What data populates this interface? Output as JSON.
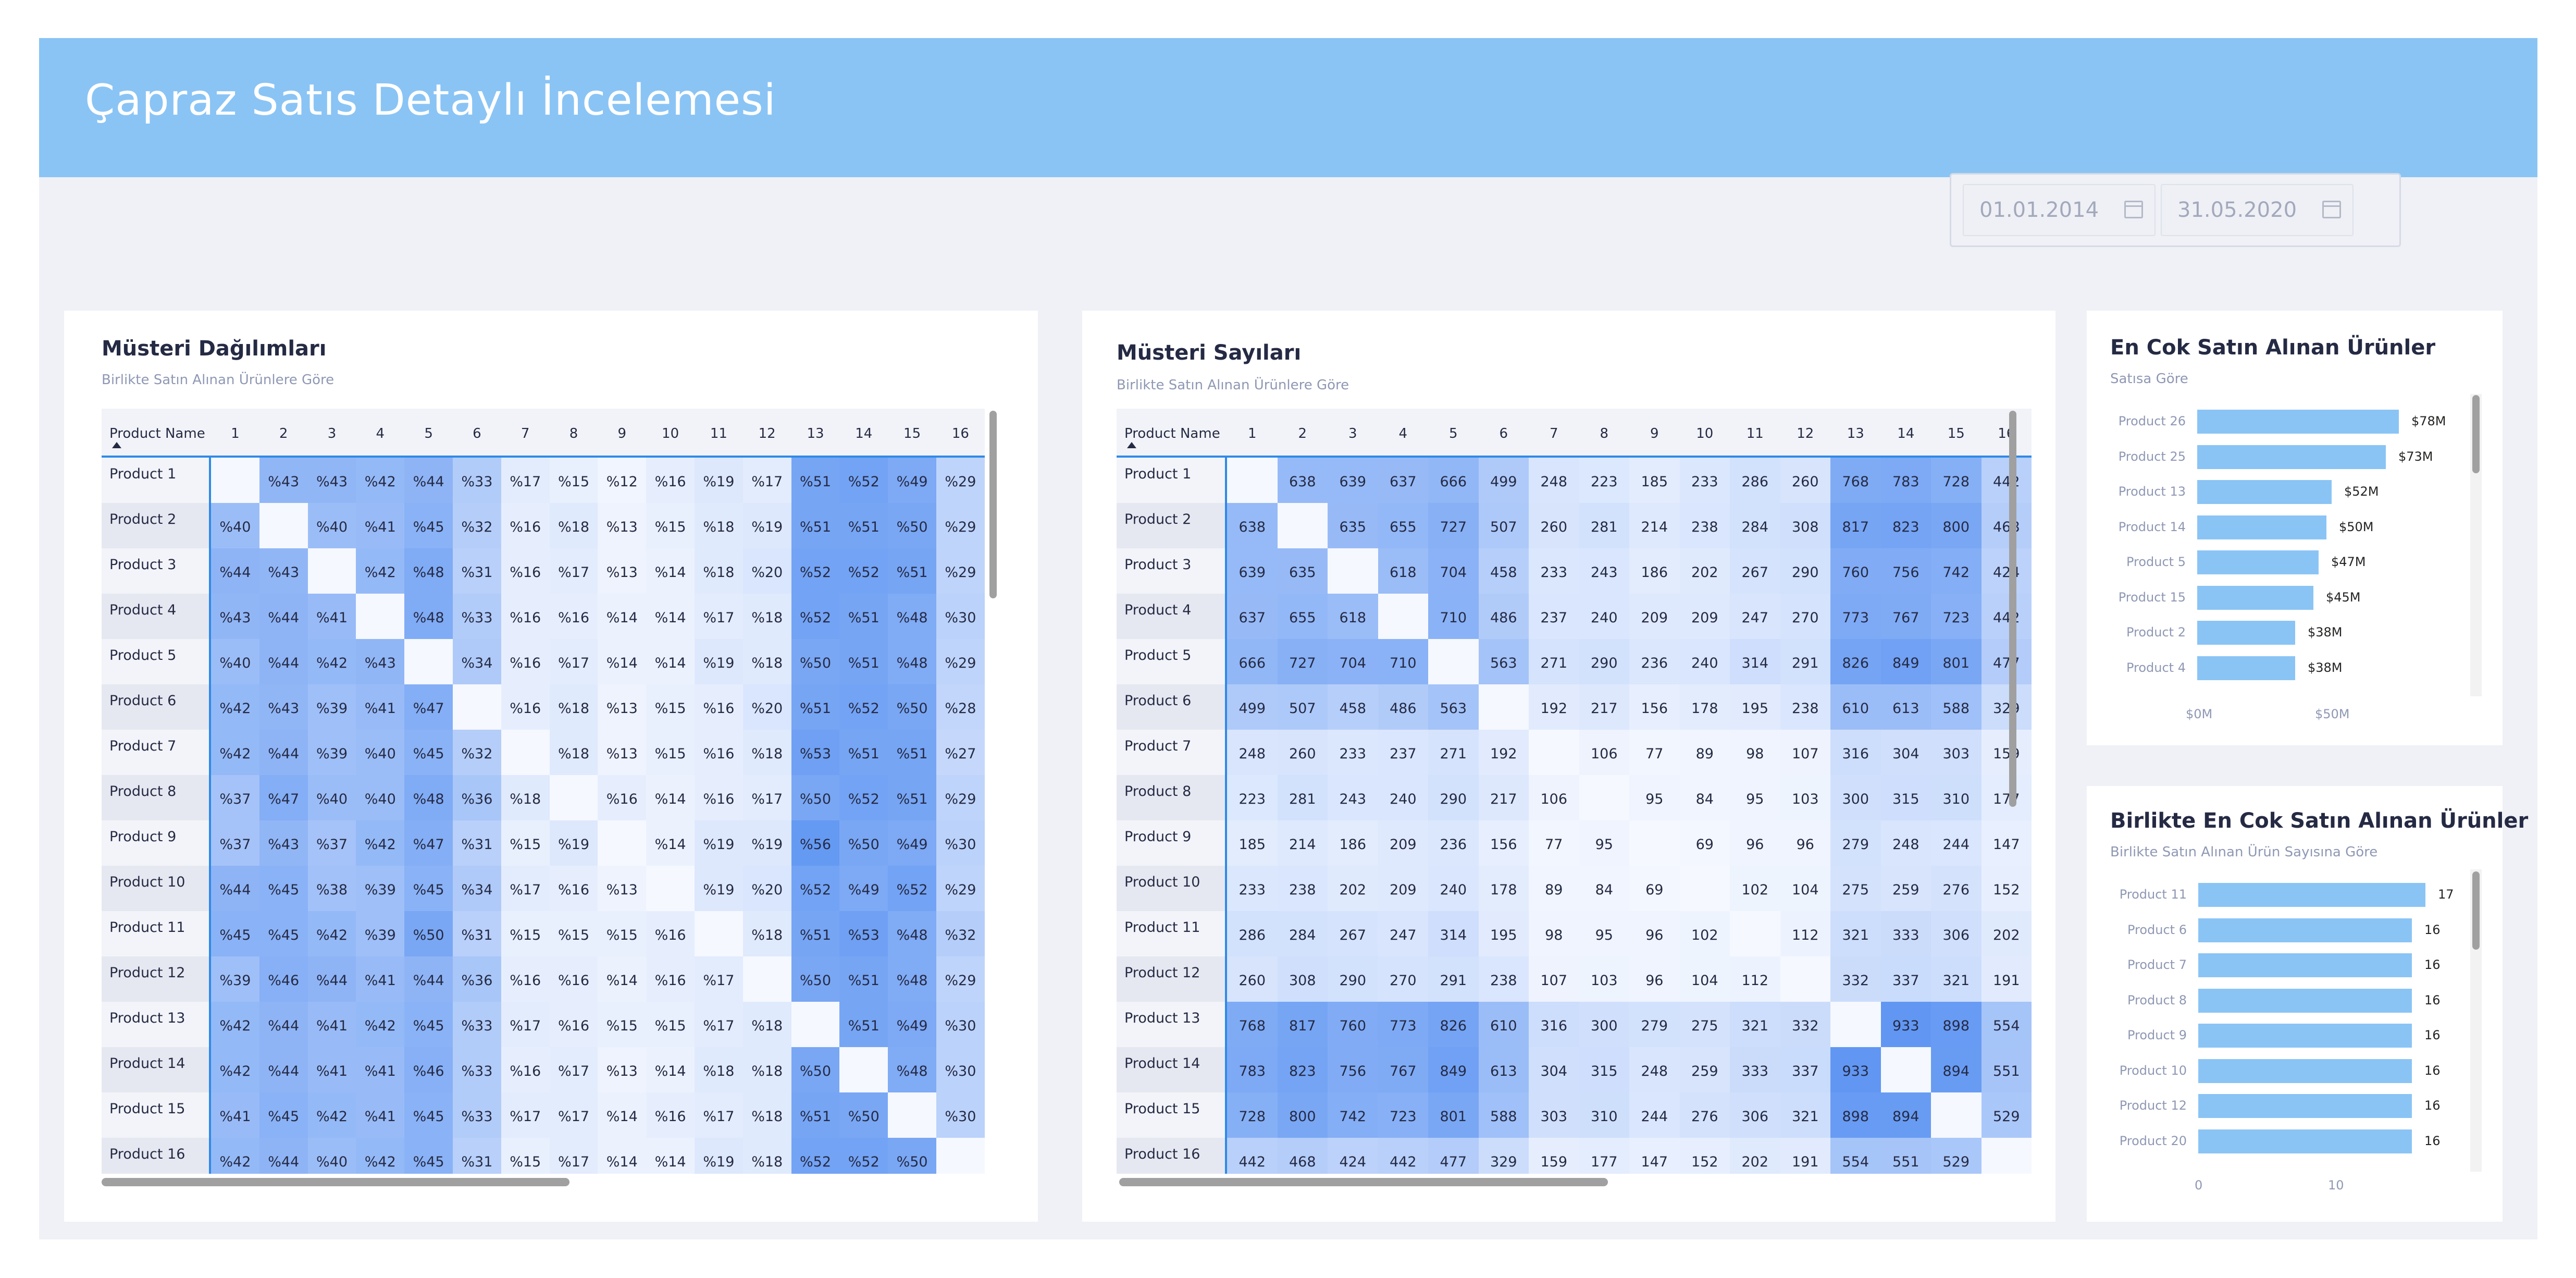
{
  "header": {
    "title": "Çapraz Satıs Detaylı İncelemesi"
  },
  "date_range": {
    "start": "01.01.2014",
    "end": "31.05.2020"
  },
  "colors": {
    "banner": "#8ac4f5",
    "background": "#eff1f6",
    "bar": "#8ac4f5",
    "heat_max": "#5e95f2",
    "accent_line": "#2f8ae8"
  },
  "panel1": {
    "title": "Müsteri Dağılımları",
    "subtitle": "Birlikte Satın Alınan Ürünlere Göre",
    "corner_label": "Product Name",
    "columns": [
      "1",
      "2",
      "3",
      "4",
      "5",
      "6",
      "7",
      "8",
      "9",
      "10",
      "11",
      "12",
      "13",
      "14",
      "15",
      "16"
    ],
    "rows": [
      {
        "label": "Product 1",
        "cells": [
          "",
          "%43",
          "%43",
          "%42",
          "%44",
          "%33",
          "%17",
          "%15",
          "%12",
          "%16",
          "%19",
          "%17",
          "%51",
          "%52",
          "%49",
          "%29"
        ]
      },
      {
        "label": "Product 2",
        "cells": [
          "%40",
          "",
          "%40",
          "%41",
          "%45",
          "%32",
          "%16",
          "%18",
          "%13",
          "%15",
          "%18",
          "%19",
          "%51",
          "%51",
          "%50",
          "%29"
        ]
      },
      {
        "label": "Product 3",
        "cells": [
          "%44",
          "%43",
          "",
          "%42",
          "%48",
          "%31",
          "%16",
          "%17",
          "%13",
          "%14",
          "%18",
          "%20",
          "%52",
          "%52",
          "%51",
          "%29"
        ]
      },
      {
        "label": "Product 4",
        "cells": [
          "%43",
          "%44",
          "%41",
          "",
          "%48",
          "%33",
          "%16",
          "%16",
          "%14",
          "%14",
          "%17",
          "%18",
          "%52",
          "%51",
          "%48",
          "%30"
        ]
      },
      {
        "label": "Product 5",
        "cells": [
          "%40",
          "%44",
          "%42",
          "%43",
          "",
          "%34",
          "%16",
          "%17",
          "%14",
          "%14",
          "%19",
          "%18",
          "%50",
          "%51",
          "%48",
          "%29"
        ]
      },
      {
        "label": "Product 6",
        "cells": [
          "%42",
          "%43",
          "%39",
          "%41",
          "%47",
          "",
          "%16",
          "%18",
          "%13",
          "%15",
          "%16",
          "%20",
          "%51",
          "%52",
          "%50",
          "%28"
        ]
      },
      {
        "label": "Product 7",
        "cells": [
          "%42",
          "%44",
          "%39",
          "%40",
          "%45",
          "%32",
          "",
          "%18",
          "%13",
          "%15",
          "%16",
          "%18",
          "%53",
          "%51",
          "%51",
          "%27"
        ]
      },
      {
        "label": "Product 8",
        "cells": [
          "%37",
          "%47",
          "%40",
          "%40",
          "%48",
          "%36",
          "%18",
          "",
          "%16",
          "%14",
          "%16",
          "%17",
          "%50",
          "%52",
          "%51",
          "%29"
        ]
      },
      {
        "label": "Product 9",
        "cells": [
          "%37",
          "%43",
          "%37",
          "%42",
          "%47",
          "%31",
          "%15",
          "%19",
          "",
          "%14",
          "%19",
          "%19",
          "%56",
          "%50",
          "%49",
          "%30"
        ]
      },
      {
        "label": "Product 10",
        "cells": [
          "%44",
          "%45",
          "%38",
          "%39",
          "%45",
          "%34",
          "%17",
          "%16",
          "%13",
          "",
          "%19",
          "%20",
          "%52",
          "%49",
          "%52",
          "%29"
        ]
      },
      {
        "label": "Product 11",
        "cells": [
          "%45",
          "%45",
          "%42",
          "%39",
          "%50",
          "%31",
          "%15",
          "%15",
          "%15",
          "%16",
          "",
          "%18",
          "%51",
          "%53",
          "%48",
          "%32"
        ]
      },
      {
        "label": "Product 12",
        "cells": [
          "%39",
          "%46",
          "%44",
          "%41",
          "%44",
          "%36",
          "%16",
          "%16",
          "%14",
          "%16",
          "%17",
          "",
          "%50",
          "%51",
          "%48",
          "%29"
        ]
      },
      {
        "label": "Product 13",
        "cells": [
          "%42",
          "%44",
          "%41",
          "%42",
          "%45",
          "%33",
          "%17",
          "%16",
          "%15",
          "%15",
          "%17",
          "%18",
          "",
          "%51",
          "%49",
          "%30"
        ]
      },
      {
        "label": "Product 14",
        "cells": [
          "%42",
          "%44",
          "%41",
          "%41",
          "%46",
          "%33",
          "%16",
          "%17",
          "%13",
          "%14",
          "%18",
          "%18",
          "%50",
          "",
          "%48",
          "%30"
        ]
      },
      {
        "label": "Product 15",
        "cells": [
          "%41",
          "%45",
          "%42",
          "%41",
          "%45",
          "%33",
          "%17",
          "%17",
          "%14",
          "%16",
          "%17",
          "%18",
          "%51",
          "%50",
          "",
          "%30"
        ]
      },
      {
        "label": "Product 16",
        "cells": [
          "%42",
          "%44",
          "%40",
          "%42",
          "%45",
          "%31",
          "%15",
          "%17",
          "%14",
          "%14",
          "%19",
          "%18",
          "%52",
          "%52",
          "%50",
          ""
        ]
      }
    ]
  },
  "panel2": {
    "title": "Müsteri Sayıları",
    "subtitle": "Birlikte Satın Alınan Ürünlere Göre",
    "corner_label": "Product Name",
    "columns": [
      "1",
      "2",
      "3",
      "4",
      "5",
      "6",
      "7",
      "8",
      "9",
      "10",
      "11",
      "12",
      "13",
      "14",
      "15",
      "16"
    ],
    "rows": [
      {
        "label": "Product 1",
        "cells": [
          "",
          "638",
          "639",
          "637",
          "666",
          "499",
          "248",
          "223",
          "185",
          "233",
          "286",
          "260",
          "768",
          "783",
          "728",
          "442"
        ]
      },
      {
        "label": "Product 2",
        "cells": [
          "638",
          "",
          "635",
          "655",
          "727",
          "507",
          "260",
          "281",
          "214",
          "238",
          "284",
          "308",
          "817",
          "823",
          "800",
          "468"
        ]
      },
      {
        "label": "Product 3",
        "cells": [
          "639",
          "635",
          "",
          "618",
          "704",
          "458",
          "233",
          "243",
          "186",
          "202",
          "267",
          "290",
          "760",
          "756",
          "742",
          "424"
        ]
      },
      {
        "label": "Product 4",
        "cells": [
          "637",
          "655",
          "618",
          "",
          "710",
          "486",
          "237",
          "240",
          "209",
          "209",
          "247",
          "270",
          "773",
          "767",
          "723",
          "442"
        ]
      },
      {
        "label": "Product 5",
        "cells": [
          "666",
          "727",
          "704",
          "710",
          "",
          "563",
          "271",
          "290",
          "236",
          "240",
          "314",
          "291",
          "826",
          "849",
          "801",
          "477"
        ]
      },
      {
        "label": "Product 6",
        "cells": [
          "499",
          "507",
          "458",
          "486",
          "563",
          "",
          "192",
          "217",
          "156",
          "178",
          "195",
          "238",
          "610",
          "613",
          "588",
          "329"
        ]
      },
      {
        "label": "Product 7",
        "cells": [
          "248",
          "260",
          "233",
          "237",
          "271",
          "192",
          "",
          "106",
          "77",
          "89",
          "98",
          "107",
          "316",
          "304",
          "303",
          "159"
        ]
      },
      {
        "label": "Product 8",
        "cells": [
          "223",
          "281",
          "243",
          "240",
          "290",
          "217",
          "106",
          "",
          "95",
          "84",
          "95",
          "103",
          "300",
          "315",
          "310",
          "177"
        ]
      },
      {
        "label": "Product 9",
        "cells": [
          "185",
          "214",
          "186",
          "209",
          "236",
          "156",
          "77",
          "95",
          "",
          "69",
          "96",
          "96",
          "279",
          "248",
          "244",
          "147"
        ]
      },
      {
        "label": "Product 10",
        "cells": [
          "233",
          "238",
          "202",
          "209",
          "240",
          "178",
          "89",
          "84",
          "69",
          "",
          "102",
          "104",
          "275",
          "259",
          "276",
          "152"
        ]
      },
      {
        "label": "Product 11",
        "cells": [
          "286",
          "284",
          "267",
          "247",
          "314",
          "195",
          "98",
          "95",
          "96",
          "102",
          "",
          "112",
          "321",
          "333",
          "306",
          "202"
        ]
      },
      {
        "label": "Product 12",
        "cells": [
          "260",
          "308",
          "290",
          "270",
          "291",
          "238",
          "107",
          "103",
          "96",
          "104",
          "112",
          "",
          "332",
          "337",
          "321",
          "191"
        ]
      },
      {
        "label": "Product 13",
        "cells": [
          "768",
          "817",
          "760",
          "773",
          "826",
          "610",
          "316",
          "300",
          "279",
          "275",
          "321",
          "332",
          "",
          "933",
          "898",
          "554"
        ]
      },
      {
        "label": "Product 14",
        "cells": [
          "783",
          "823",
          "756",
          "767",
          "849",
          "613",
          "304",
          "315",
          "248",
          "259",
          "333",
          "337",
          "933",
          "",
          "894",
          "551"
        ]
      },
      {
        "label": "Product 15",
        "cells": [
          "728",
          "800",
          "742",
          "723",
          "801",
          "588",
          "303",
          "310",
          "244",
          "276",
          "306",
          "321",
          "898",
          "894",
          "",
          "529"
        ]
      },
      {
        "label": "Product 16",
        "cells": [
          "442",
          "468",
          "424",
          "442",
          "477",
          "329",
          "159",
          "177",
          "147",
          "152",
          "202",
          "191",
          "554",
          "551",
          "529",
          ""
        ]
      }
    ]
  },
  "top_products": {
    "title": "En Cok Satın Alınan Ürünler",
    "subtitle": "Satısa Göre",
    "items": [
      {
        "label": "Product 26",
        "value": 78,
        "display": "$78M"
      },
      {
        "label": "Product 25",
        "value": 73,
        "display": "$73M"
      },
      {
        "label": "Product 13",
        "value": 52,
        "display": "$52M"
      },
      {
        "label": "Product 14",
        "value": 50,
        "display": "$50M"
      },
      {
        "label": "Product 5",
        "value": 47,
        "display": "$47M"
      },
      {
        "label": "Product 15",
        "value": 45,
        "display": "$45M"
      },
      {
        "label": "Product 2",
        "value": 38,
        "display": "$38M"
      },
      {
        "label": "Product 4",
        "value": 38,
        "display": "$38M"
      }
    ],
    "ticks": [
      {
        "value": 0,
        "label": "$0M"
      },
      {
        "value": 50,
        "label": "$50M"
      }
    ]
  },
  "together_products": {
    "title": "Birlikte En Cok Satın Alınan Ürünler",
    "subtitle": "Birlikte Satın Alınan Ürün Sayısına Göre",
    "items": [
      {
        "label": "Product 11",
        "value": 17,
        "display": "17"
      },
      {
        "label": "Product 6",
        "value": 16,
        "display": "16"
      },
      {
        "label": "Product 7",
        "value": 16,
        "display": "16"
      },
      {
        "label": "Product 8",
        "value": 16,
        "display": "16"
      },
      {
        "label": "Product 9",
        "value": 16,
        "display": "16"
      },
      {
        "label": "Product 10",
        "value": 16,
        "display": "16"
      },
      {
        "label": "Product 12",
        "value": 16,
        "display": "16"
      },
      {
        "label": "Product 20",
        "value": 16,
        "display": "16"
      }
    ],
    "ticks": [
      {
        "value": 0,
        "label": "0"
      },
      {
        "value": 10,
        "label": "10"
      }
    ]
  }
}
